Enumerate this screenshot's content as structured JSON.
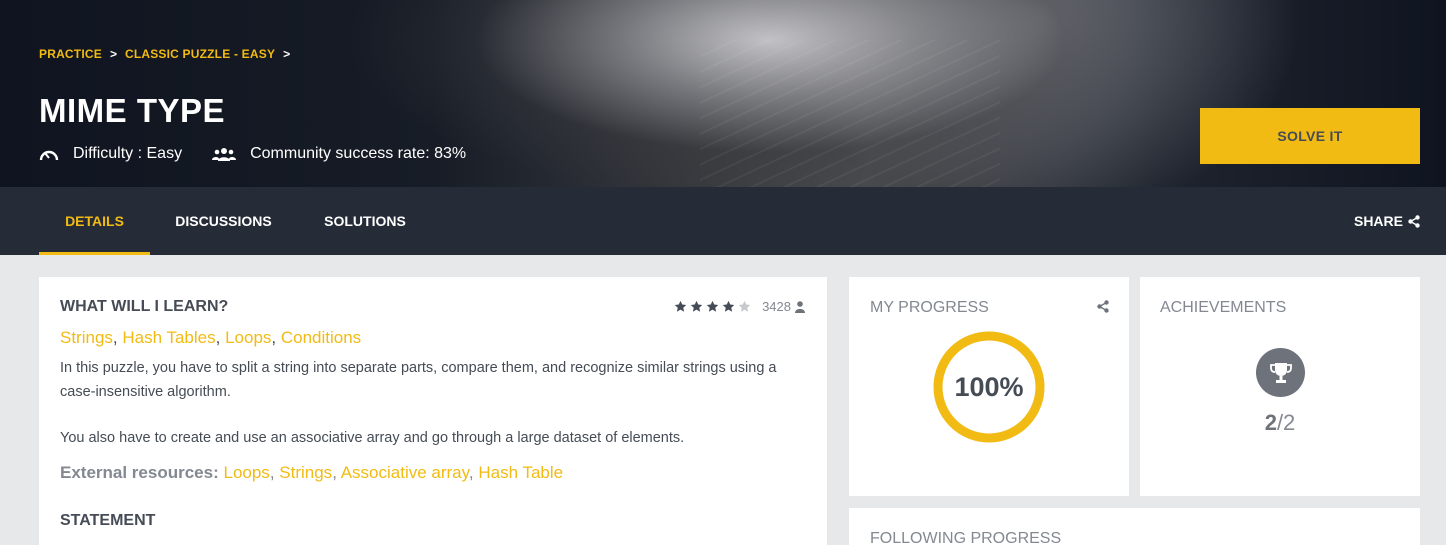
{
  "breadcrumb": {
    "items": [
      "PRACTICE",
      "CLASSIC PUZZLE - EASY"
    ],
    "separator": ">"
  },
  "puzzle": {
    "title": "MIME TYPE",
    "difficulty": "Difficulty : Easy",
    "success_rate": "Community success rate: 83%",
    "solve_label": "SOLVE IT"
  },
  "tabs": [
    {
      "label": "DETAILS",
      "active": true
    },
    {
      "label": "DISCUSSIONS",
      "active": false
    },
    {
      "label": "SOLUTIONS",
      "active": false
    }
  ],
  "share_label": "SHARE",
  "learn": {
    "title": "WHAT WILL I LEARN?",
    "rating_stars": 4,
    "rating_max": 5,
    "rating_count": "3428",
    "tags": [
      "Strings",
      "Hash Tables",
      "Loops",
      "Conditions"
    ],
    "tag_separator": ", ",
    "description_1": "In this puzzle, you have to split a string into separate parts, compare them, and recognize similar strings using a case-insensitive algorithm.",
    "description_2": "You also have to create and use an associative array and go through a large dataset of elements.",
    "external_label": "External resources:",
    "external_links": [
      "Loops",
      "Strings",
      "Associative array",
      "Hash Table"
    ],
    "statement_title": "STATEMENT"
  },
  "progress": {
    "title": "MY PROGRESS",
    "value_label": "100%",
    "fraction": 1.0
  },
  "achievements": {
    "title": "ACHIEVEMENTS",
    "earned": "2",
    "total": "/2"
  },
  "following": {
    "title": "FOLLOWING PROGRESS"
  },
  "colors": {
    "accent": "#f2bb13",
    "dark": "#252b37",
    "text": "#454c55",
    "muted": "#838891"
  },
  "icons": {
    "difficulty": "speedometer-icon",
    "community": "users-icon",
    "share": "share-icon",
    "star": "star-icon",
    "user": "user-icon",
    "trophy": "trophy-icon"
  }
}
